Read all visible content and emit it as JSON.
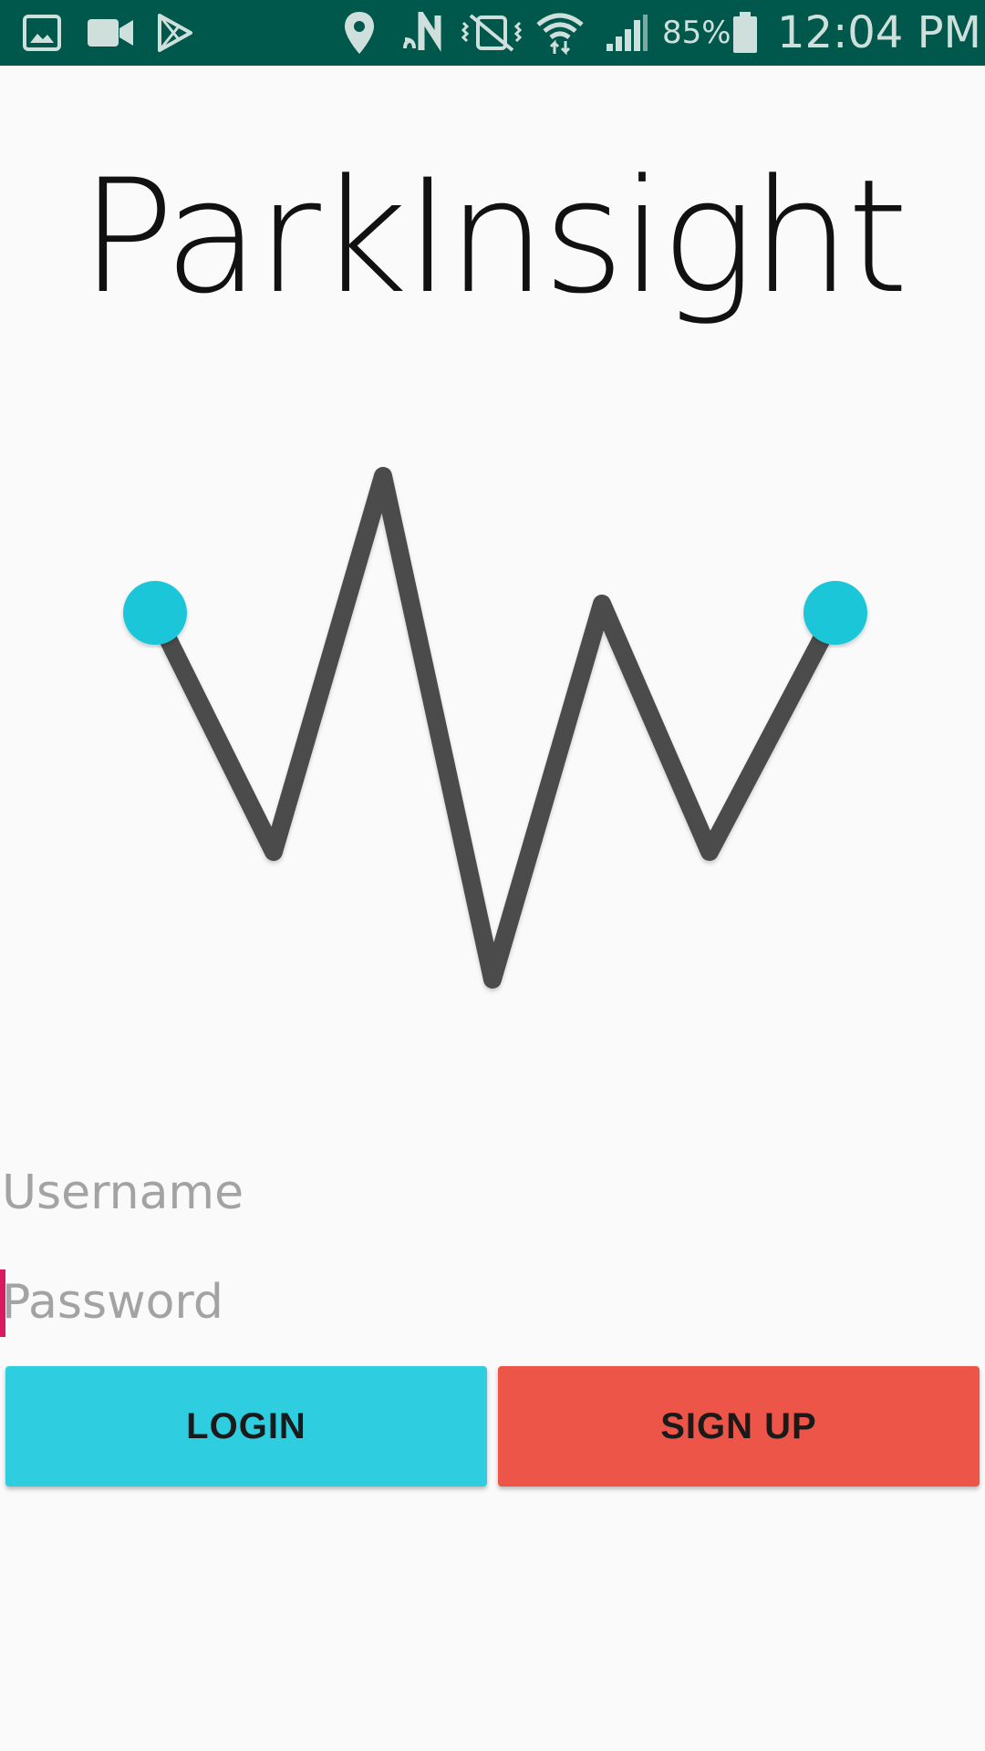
{
  "status_bar": {
    "battery": "85%",
    "time": "12:04 PM",
    "icons": [
      "gallery-icon",
      "video-icon",
      "play-store-icon",
      "location-icon",
      "nfc-icon",
      "vibrate-icon",
      "wifi-icon",
      "signal-icon",
      "battery-icon"
    ],
    "background": "#00574b"
  },
  "app": {
    "title": "ParkInsight"
  },
  "logo": {
    "line_color": "#4b4c4b",
    "dot_color": "#1dc6d9"
  },
  "form": {
    "username_placeholder": "Username",
    "username_value": "",
    "password_placeholder": "Password",
    "password_value": ""
  },
  "buttons": {
    "login_label": "LOGIN",
    "signup_label": "SIGN UP",
    "login_color": "#2ecde0",
    "signup_color": "#ec5548"
  }
}
